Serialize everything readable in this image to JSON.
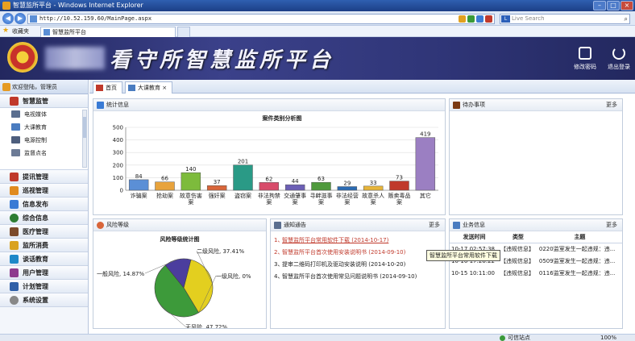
{
  "browser": {
    "window_title": "智慧监所平台 - Windows Internet Explorer",
    "url": "http://10.52.159.60/MainPage.aspx",
    "search_placeholder": "Live Search",
    "favorites_label": "收藏夹",
    "tab_title": "智慧监所平台",
    "status_zone": "可信站点",
    "zoom": "100%"
  },
  "header": {
    "title": "看守所智慧监所平台",
    "change_password": "修改密码",
    "logout": "退出登录"
  },
  "sidebar": {
    "welcome": "欢迎登陆，管理员",
    "active_section": "智慧监管",
    "sub_items": [
      "电视媒体",
      "大课教育",
      "电源控制",
      "监督点名"
    ],
    "sections": [
      "提讯管理",
      "巡视管理",
      "信息发布",
      "综合信息",
      "医疗管理",
      "监所消费",
      "谈话教育",
      "用户管理",
      "计划管理",
      "系统设置"
    ]
  },
  "tabs": [
    {
      "label": "首页"
    },
    {
      "label": "大课教育",
      "close": "×"
    }
  ],
  "stats_panel": {
    "title": "统计信息"
  },
  "todo_panel": {
    "title": "待办事项",
    "more": "更多"
  },
  "risk_panel": {
    "title": "风险等级"
  },
  "notice_panel": {
    "title": "通知通告",
    "more": "更多",
    "items": [
      {
        "num": "1、",
        "text": "智慧监所平台常用软件下载 (2014-10-17)",
        "color": "#c0392b"
      },
      {
        "num": "2、",
        "text": "智慧监所平台首次使用安装说明书 (2014-09-10)",
        "color": "#c0392b"
      },
      {
        "num": "3、",
        "text": "提审二维码打印机及驱动安装说明 (2014-10-20)",
        "color": "#222222"
      },
      {
        "num": "4、",
        "text": "智慧监所平台首次使用常见问题说明书 (2014-09-10)",
        "color": "#222222"
      }
    ],
    "tooltip": "智慧监所平台常用软件下载"
  },
  "business_panel": {
    "title": "业务信息",
    "more": "更多",
    "columns": [
      "发送时间",
      "类型",
      "主题"
    ],
    "rows": [
      [
        "10-17 02:57:38",
        "【违规信息】",
        "0220监室发生一起违规：违..."
      ],
      [
        "10-16 17:26:22",
        "【违规信息】",
        "0509监室发生一起违规：违..."
      ],
      [
        "10-15 10:11:00",
        "【违规信息】",
        "0116监室发生一起违规：违..."
      ]
    ]
  },
  "chart_data": [
    {
      "type": "bar",
      "title": "案件类别分析图",
      "categories": [
        "诈骗案",
        "抢劫案",
        "故意伤害案",
        "强奸案",
        "盗窃案",
        "非法拘禁案",
        "交通肇事案",
        "寻衅滋事案",
        "非法经营案",
        "故意杀人案",
        "贩卖毒品案",
        "其它"
      ],
      "values": [
        84,
        66,
        140,
        37,
        201,
        62,
        44,
        63,
        29,
        33,
        73,
        419
      ],
      "colors": [
        "#5b8fd6",
        "#e8a33c",
        "#7dbb3c",
        "#d9663a",
        "#2a9a86",
        "#d84b6a",
        "#6c5fb5",
        "#4f9a3d",
        "#2b6bb3",
        "#e7b53a",
        "#c0392b",
        "#9b7fc2"
      ],
      "ylim": [
        0,
        500
      ],
      "yticks": [
        0,
        100,
        200,
        300,
        400,
        500
      ],
      "grid": true,
      "legend": "none"
    },
    {
      "type": "pie",
      "title": "风险等级统计图",
      "slices": [
        {
          "label": "二级风险",
          "value": 37.41,
          "display": "二级风险, 37.41%",
          "color": "#e3cf1f"
        },
        {
          "label": "一级风险",
          "value": 0,
          "display": "一级风险, 0%",
          "color": "#c0392b"
        },
        {
          "label": "无风险",
          "value": 47.72,
          "display": "无风险, 47.72%",
          "color": "#3d9a3a"
        },
        {
          "label": "一般风险",
          "value": 14.87,
          "display": "一般风险, 14.87%",
          "color": "#4b3d9e"
        }
      ]
    }
  ]
}
